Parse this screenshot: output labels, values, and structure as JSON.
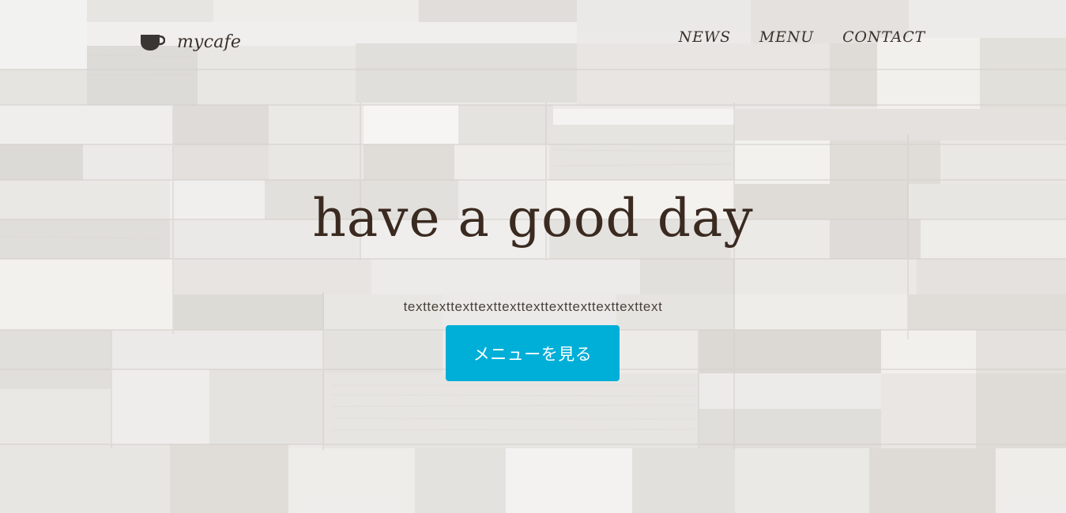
{
  "header": {
    "logo": {
      "icon": "coffee-cup-icon",
      "text": "mycafe"
    },
    "nav": {
      "items": [
        {
          "label": "NEWS"
        },
        {
          "label": "MENU"
        },
        {
          "label": "CONTACT"
        }
      ]
    }
  },
  "hero": {
    "title": "have a good day",
    "subtitle": "texttexttexttexttexttexttexttexttexttexttext",
    "cta_label": "メニューを見る",
    "background": "wood-block-wall"
  },
  "colors": {
    "text_dark": "#3a2a20",
    "nav_text": "#3a312c",
    "button": "#00afd8",
    "button_text": "#ffffff",
    "background": "#e9e7e4"
  }
}
